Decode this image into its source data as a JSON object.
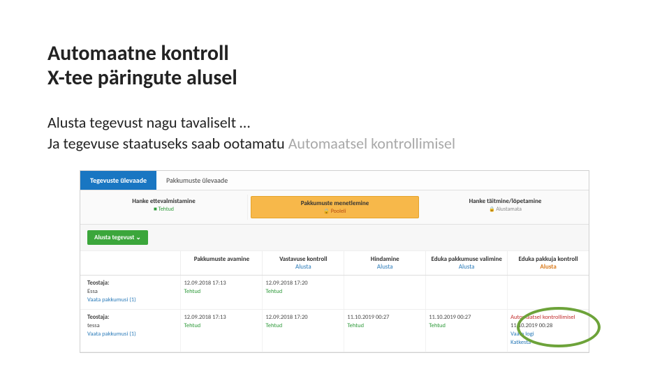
{
  "title_line1": "Automaatne kontroll",
  "title_line2": "X-tee päringute alusel",
  "para1": "Alusta tegevust nagu tavaliselt …",
  "para2a": "Ja tegevuse staatuseks saab ootamatu ",
  "para2b": "Automaatsel kontrollimisel",
  "tabs": {
    "active": "Tegevuste ülevaade",
    "inactive": "Pakkumuste ülevaade"
  },
  "phases": {
    "p1": {
      "title": "Hanke ettevalmistamine",
      "sub": "Tehtud"
    },
    "p2": {
      "title": "Pakkumuste menetlemine",
      "sub": "Pooleli"
    },
    "p3": {
      "title": "Hanke täitmine/lõpetamine",
      "sub": "Alustamata"
    }
  },
  "start_btn": "Alusta tegevust",
  "subtabs": {
    "c1": "Pakkumuste avamine",
    "c2": {
      "head": "Vastavuse kontroll",
      "link": "Alusta"
    },
    "c3": {
      "head": "Hindamine",
      "link": "Alusta"
    },
    "c4": {
      "head": "Eduka pakkumuse valimine",
      "link": "Alusta"
    },
    "c5": {
      "head": "Eduka pakkuja kontroll",
      "link": "Alusta"
    }
  },
  "rows": [
    {
      "teostaja": "Teostaja:",
      "name": "Essa",
      "view": "Vaata pakkumusi (1)",
      "c1": {
        "date": "12.09.2018 17:13",
        "status": "Tehtud"
      },
      "c2": {
        "date": "12.09.2018 17:20",
        "status": "Tehtud"
      },
      "c3": "",
      "c4": "",
      "c5": ""
    },
    {
      "teostaja": "Teostaja:",
      "name": "tessa",
      "view": "Vaata pakkumusi (1)",
      "c1": {
        "date": "12.09.2018 17:13",
        "status": "Tehtud"
      },
      "c2": {
        "date": "12.09.2018 17:20",
        "status": "Tehtud"
      },
      "c3": {
        "date": "11.10.2019 00:27",
        "status": "Tehtud"
      },
      "c4": {
        "date": "11.10.2019 00:27",
        "status": "Tehtud"
      },
      "c5": {
        "auto": "Automaatsel kontrollimisel",
        "date": "11.10.2019 00:28",
        "log": "Vaata logi",
        "cancel": "Katkesta"
      }
    }
  ]
}
